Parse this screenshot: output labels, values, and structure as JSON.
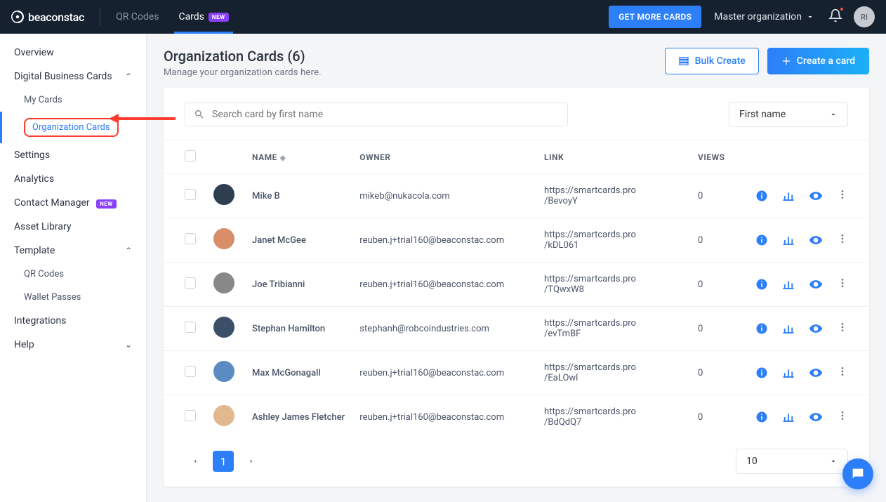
{
  "topbar": {
    "brand": "beaconstac",
    "tabs": {
      "qr": "QR Codes",
      "cards": "Cards",
      "new": "NEW"
    },
    "get_more": "GET MORE CARDS",
    "org": "Master organization",
    "avatar_initials": "RI"
  },
  "sidebar": {
    "overview": "Overview",
    "dbc": "Digital Business Cards",
    "my_cards": "My Cards",
    "org_cards": "Organization Cards",
    "settings": "Settings",
    "analytics": "Analytics",
    "contact_mgr": "Contact Manager",
    "contact_mgr_badge": "NEW",
    "asset_lib": "Asset Library",
    "template": "Template",
    "tpl_qr": "QR Codes",
    "tpl_wp": "Wallet Passes",
    "integrations": "Integrations",
    "help": "Help"
  },
  "page": {
    "title": "Organization Cards (6)",
    "subtitle": "Manage your organization cards here.",
    "bulk_create": "Bulk Create",
    "create_card": "Create a card"
  },
  "filters": {
    "search_placeholder": "Search card by first name",
    "sort_value": "First name"
  },
  "columns": {
    "name": "NAME",
    "owner": "OWNER",
    "link": "LINK",
    "views": "VIEWS"
  },
  "rows": [
    {
      "name": "Mike B",
      "owner": "mikeb@nukacola.com",
      "link": "https://smartcards.pro/BevoyY",
      "views": "0"
    },
    {
      "name": "Janet McGee",
      "owner": "reuben.j+trial160@beaconstac.com",
      "link": "https://smartcards.pro/kDL061",
      "views": "0"
    },
    {
      "name": "Joe Tribianni",
      "owner": "reuben.j+trial160@beaconstac.com",
      "link": "https://smartcards.pro/TQwxW8",
      "views": "0"
    },
    {
      "name": "Stephan Hamilton",
      "owner": "stephanh@robcoindustries.com",
      "link": "https://smartcards.pro/evTmBF",
      "views": "0"
    },
    {
      "name": "Max McGonagall",
      "owner": "reuben.j+trial160@beaconstac.com",
      "link": "https://smartcards.pro/EaLOwl",
      "views": "0"
    },
    {
      "name": "Ashley James Fletcher",
      "owner": "reuben.j+trial160@beaconstac.com",
      "link": "https://smartcards.pro/BdQdQ7",
      "views": "0"
    }
  ],
  "pagination": {
    "current": "1",
    "page_size": "10"
  }
}
